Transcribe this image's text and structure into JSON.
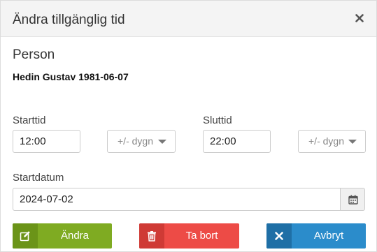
{
  "dialog": {
    "title": "Ändra tillgänglig tid",
    "close_icon": "close-icon"
  },
  "person": {
    "section_label": "Person",
    "name": "Hedin Gustav 1981-06-07"
  },
  "start_time": {
    "label": "Starttid",
    "value": "12:00",
    "day_offset": "+/- dygn"
  },
  "end_time": {
    "label": "Sluttid",
    "value": "22:00",
    "day_offset": "+/- dygn"
  },
  "start_date": {
    "label": "Startdatum",
    "value": "2024-07-02",
    "calendar_icon": "calendar-icon"
  },
  "buttons": {
    "edit": {
      "label": "Ändra",
      "icon": "edit-icon",
      "color": "#7fab22"
    },
    "delete": {
      "label": "Ta bort",
      "icon": "trash-icon",
      "color": "#ed4b46"
    },
    "cancel": {
      "label": "Avbryt",
      "icon": "x-icon",
      "color": "#2b8ccb"
    }
  }
}
